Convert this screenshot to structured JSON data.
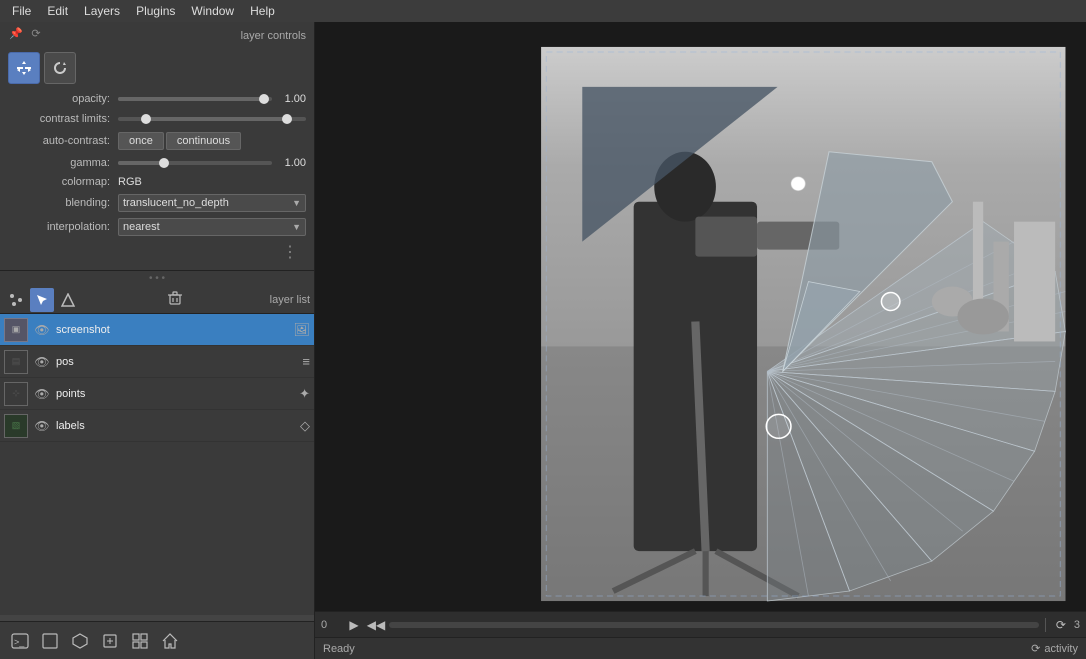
{
  "menubar": {
    "items": [
      "File",
      "Edit",
      "Layers",
      "Plugins",
      "Window",
      "Help"
    ]
  },
  "layer_controls": {
    "title": "layer controls",
    "opacity_label": "opacity:",
    "opacity_value": "1.00",
    "opacity_percent": 95,
    "contrast_label": "contrast limits:",
    "contrast_low": 15,
    "contrast_high": 90,
    "auto_contrast_label": "auto-contrast:",
    "once_label": "once",
    "continuous_label": "continuous",
    "gamma_label": "gamma:",
    "gamma_value": "1.00",
    "gamma_percent": 30,
    "colormap_label": "colormap:",
    "colormap_value": "RGB",
    "blending_label": "blending:",
    "blending_value": "translucent_no_depth",
    "interpolation_label": "interpolation:",
    "interpolation_value": "nearest"
  },
  "layer_list": {
    "title": "layer list",
    "layers": [
      {
        "name": "screenshot",
        "type": "image",
        "visible": true,
        "active": true
      },
      {
        "name": "pos",
        "type": "tracks",
        "visible": true,
        "active": false
      },
      {
        "name": "points",
        "type": "points",
        "visible": true,
        "active": false
      },
      {
        "name": "labels",
        "type": "labels",
        "visible": true,
        "active": false
      }
    ]
  },
  "playback": {
    "current_frame": "0",
    "total_frames": "3",
    "progress": 0
  },
  "status": {
    "ready_text": "Ready",
    "activity_text": "activity"
  },
  "bottom_tools": [
    {
      "name": "console",
      "icon": ">_"
    },
    {
      "name": "2d-view",
      "icon": "□"
    },
    {
      "name": "3d-view",
      "icon": "⬡"
    },
    {
      "name": "3d-roll",
      "icon": "↺"
    },
    {
      "name": "grid",
      "icon": "⊞"
    },
    {
      "name": "home",
      "icon": "⌂"
    }
  ]
}
